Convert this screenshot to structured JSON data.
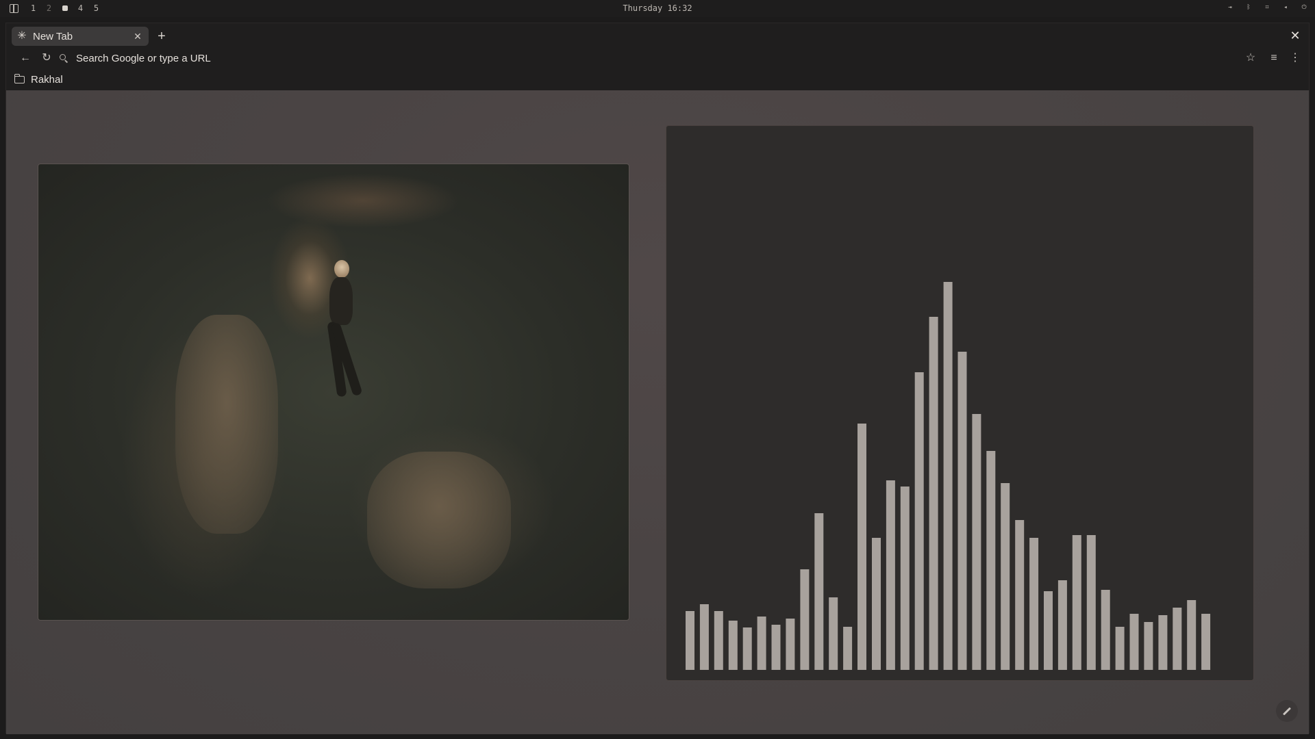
{
  "topbar": {
    "workspaces": [
      "1",
      "2",
      "3",
      "4",
      "5"
    ],
    "active_workspace": "3",
    "clock": "Thursday 16:32",
    "tray_icons": [
      "logout-icon",
      "bluetooth-icon",
      "network-icon",
      "volume-icon",
      "power-icon"
    ]
  },
  "browser": {
    "tab": {
      "title": "New Tab",
      "icon": "asterisk-icon"
    },
    "omnibox": {
      "placeholder": "Search Google or type a URL",
      "value": ""
    },
    "bookmarks": [
      {
        "label": "Rakhal",
        "icon": "folder-icon"
      }
    ]
  },
  "content": {
    "photo": {
      "subject": "person-floating-underwater-with-hands"
    },
    "visualizer": {
      "bar_color": "#a8a29d"
    }
  },
  "chart_data": {
    "type": "bar",
    "values": [
      86,
      96,
      86,
      72,
      62,
      78,
      66,
      75,
      147,
      229,
      106,
      63,
      360,
      193,
      277,
      268,
      435,
      516,
      567,
      465,
      374,
      320,
      273,
      219,
      193,
      115,
      131,
      197,
      197,
      117,
      63,
      82,
      70,
      80,
      91,
      102,
      82
    ],
    "ylim": [
      0,
      620
    ]
  },
  "colors": {
    "accent": "#e6e1dc",
    "panel_bg": "#2e2c2b",
    "page_bg": "#4a4444"
  }
}
